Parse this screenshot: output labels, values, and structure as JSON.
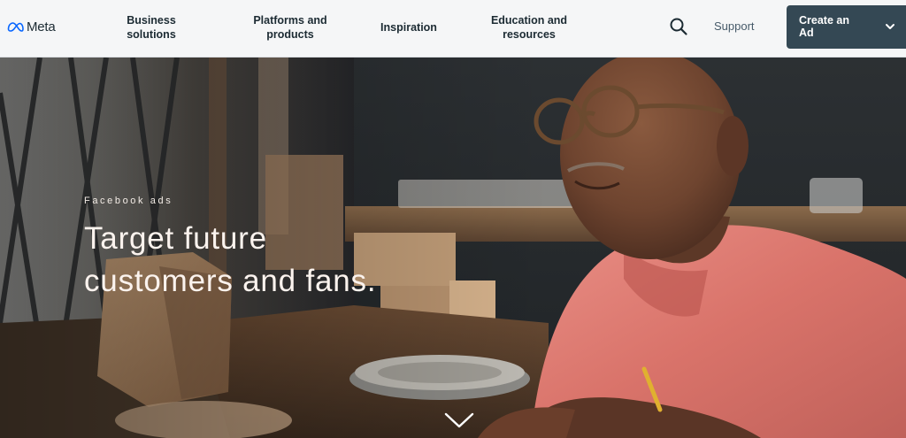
{
  "brand": {
    "name": "Meta"
  },
  "nav": {
    "items": [
      {
        "line1": "Business",
        "line2": "solutions"
      },
      {
        "line1": "Platforms and",
        "line2": "products"
      },
      {
        "line1": "Inspiration",
        "line2": ""
      },
      {
        "line1": "Education and",
        "line2": "resources"
      }
    ],
    "support_label": "Support",
    "cta": {
      "line1": "Create an",
      "line2": "Ad"
    }
  },
  "hero": {
    "eyebrow": "Facebook ads",
    "headline_line1": "Target future",
    "headline_line2": "customers and fans."
  },
  "icons": {
    "logo": "meta-infinity-icon",
    "search": "search-icon",
    "cta_toggle": "chevron-down-icon",
    "scroll": "chevron-down-icon"
  },
  "colors": {
    "nav_bg": "#f5f6f7",
    "nav_text": "#1c2b33",
    "cta_bg": "#344854",
    "logo_blue": "#0866ff",
    "hero_text": "#fbf3ee"
  }
}
